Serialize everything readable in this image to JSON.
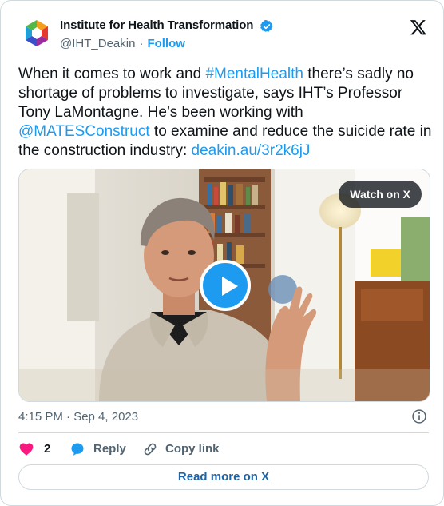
{
  "tweet": {
    "author_name": "Institute for Health Transformation",
    "handle": "@IHT_Deakin",
    "separator": "·",
    "follow_label": "Follow",
    "text_parts": {
      "p1": "When it comes to work and ",
      "hashtag": "#MentalHealth",
      "p2": " there’s sadly no shortage of problems to investigate, says IHT’s Professor Tony LaMontagne. He’s been working with ",
      "mention": "@MATESConstruct",
      "p3": " to examine and reduce the suicide rate in the construction industry: ",
      "url": "deakin.au/3r2k6jJ"
    },
    "timestamp": "4:15 PM · Sep 4, 2023"
  },
  "media": {
    "watch_label": "Watch on X",
    "play_icon": "play-icon"
  },
  "actions": {
    "like_count": "2",
    "reply_label": "Reply",
    "copy_label": "Copy link"
  },
  "footer": {
    "read_more_label": "Read more on X"
  },
  "colors": {
    "accent": "#1d9bf0",
    "like": "#f91880",
    "text": "#0f1419",
    "muted": "#536471",
    "border": "#cfd9de"
  },
  "icons": [
    "brand-logo-icon",
    "verified-badge-icon",
    "x-logo-icon",
    "info-icon",
    "heart-icon",
    "reply-bubble-icon",
    "link-icon"
  ]
}
